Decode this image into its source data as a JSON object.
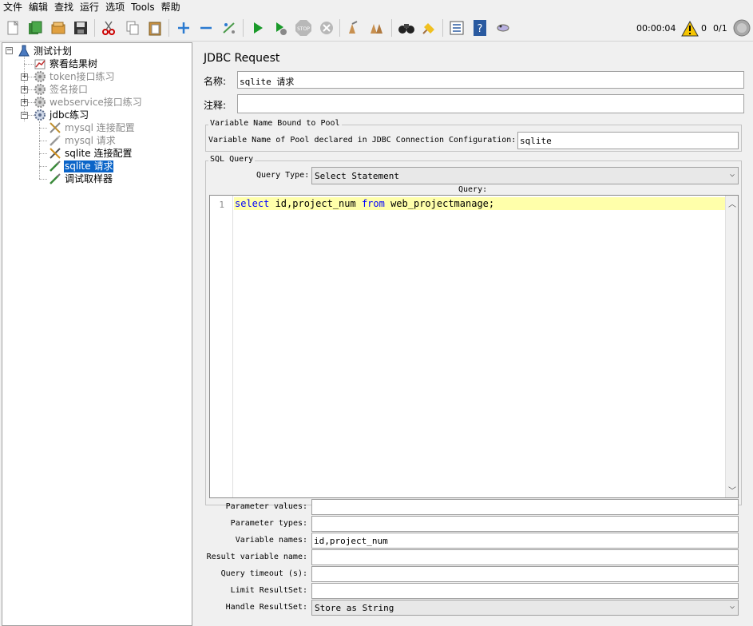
{
  "menu": [
    "文件",
    "编辑",
    "查找",
    "运行",
    "选项",
    "Tools",
    "帮助"
  ],
  "toolbar": {
    "timer": "00:00:04",
    "warnings": "0",
    "threads": "0/1"
  },
  "tree": {
    "nodes": [
      {
        "label": "测试计划",
        "state": "normal"
      },
      {
        "label": "察看结果树",
        "state": "normal"
      },
      {
        "label": "token接口练习",
        "state": "disabled"
      },
      {
        "label": "签名接口",
        "state": "disabled"
      },
      {
        "label": "webservice接口练习",
        "state": "disabled"
      },
      {
        "label": "jdbc练习",
        "state": "normal"
      },
      {
        "label": "mysql 连接配置",
        "state": "disabled"
      },
      {
        "label": "mysql 请求",
        "state": "disabled"
      },
      {
        "label": "sqlite 连接配置",
        "state": "normal"
      },
      {
        "label": "sqlite 请求",
        "state": "selected"
      },
      {
        "label": "调试取样器",
        "state": "normal"
      }
    ]
  },
  "panel": {
    "title": "JDBC Request",
    "name_label": "名称:",
    "name_value": "sqlite 请求",
    "comment_label": "注释:",
    "comment_value": "",
    "pool_group": {
      "legend": "Variable Name Bound to Pool",
      "label": "Variable Name of Pool declared in JDBC Connection Configuration:",
      "value": "sqlite"
    },
    "sql_group": {
      "legend": "SQL Query",
      "query_type_label": "Query Type:",
      "query_type_value": "Select Statement",
      "query_label": "Query:",
      "line_number": "1",
      "code": {
        "kw1": "select",
        "part1": " id,project_num ",
        "kw2": "from",
        "part2": " web_projectmanage;"
      }
    },
    "params": [
      {
        "label": "Parameter values:",
        "value": ""
      },
      {
        "label": "Parameter types:",
        "value": ""
      },
      {
        "label": "Variable names:",
        "value": "id,project_num"
      },
      {
        "label": "Result variable name:",
        "value": ""
      },
      {
        "label": "Query timeout (s):",
        "value": ""
      },
      {
        "label": "Limit ResultSet:",
        "value": ""
      }
    ],
    "handle_label": "Handle ResultSet:",
    "handle_value": "Store as String"
  }
}
